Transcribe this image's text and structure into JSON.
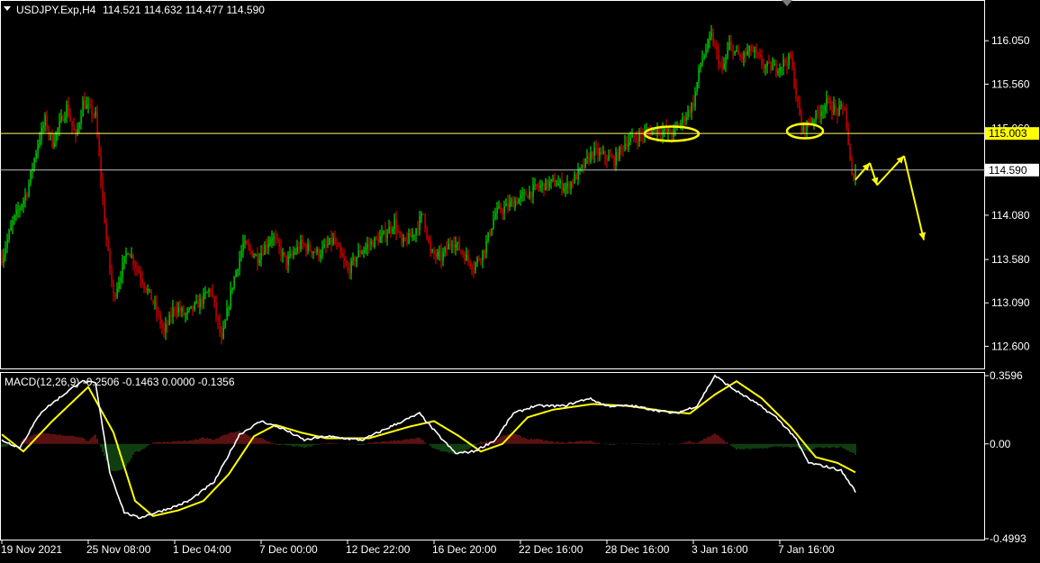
{
  "colors": {
    "background": "#000000",
    "frame": "#ffffff",
    "bull_candle": "#00ff00",
    "bear_candle": "#ff0000",
    "price_line_current": "#c0c0c0",
    "level_line": "#ffff66",
    "level_tag_bg": "#ffff00",
    "macd_main": "#ffffff",
    "macd_signal": "#ffff00",
    "hist_up": "#b22222",
    "hist_down": "#1f7a1f",
    "annotation": "#ffff00"
  },
  "chart_data": [
    {
      "type": "candlestick",
      "title": "USDJPY.Exp,H4",
      "ohlc_header": "114.521 114.632 114.477 114.590",
      "ylim": [
        112.35,
        116.5
      ],
      "y_ticks": [
        "116.050",
        "115.560",
        "115.060",
        "114.080",
        "113.580",
        "113.090",
        "112.600"
      ],
      "y_tick_values": [
        116.05,
        115.56,
        115.06,
        114.08,
        113.58,
        113.09,
        112.6
      ],
      "levels": [
        {
          "value": 115.003,
          "label": "115.003"
        }
      ],
      "current_price": {
        "value": 114.59,
        "label": "114.590"
      },
      "anchor_path": [
        [
          0,
          113.6
        ],
        [
          6,
          114.0
        ],
        [
          14,
          114.35
        ],
        [
          20,
          114.9
        ],
        [
          24,
          115.15
        ],
        [
          28,
          114.9
        ],
        [
          36,
          115.3
        ],
        [
          41,
          114.95
        ],
        [
          45,
          115.35
        ],
        [
          52,
          115.2
        ],
        [
          58,
          113.8
        ],
        [
          62,
          113.15
        ],
        [
          70,
          113.7
        ],
        [
          78,
          113.35
        ],
        [
          84,
          113.1
        ],
        [
          90,
          112.75
        ],
        [
          96,
          113.05
        ],
        [
          102,
          112.95
        ],
        [
          110,
          113.1
        ],
        [
          116,
          113.25
        ],
        [
          122,
          112.65
        ],
        [
          128,
          113.3
        ],
        [
          134,
          113.75
        ],
        [
          142,
          113.6
        ],
        [
          150,
          113.85
        ],
        [
          158,
          113.55
        ],
        [
          166,
          113.75
        ],
        [
          176,
          113.65
        ],
        [
          184,
          113.8
        ],
        [
          192,
          113.45
        ],
        [
          198,
          113.65
        ],
        [
          204,
          113.75
        ],
        [
          212,
          113.85
        ],
        [
          218,
          114.0
        ],
        [
          222,
          113.75
        ],
        [
          228,
          113.85
        ],
        [
          234,
          114.1
        ],
        [
          238,
          113.65
        ],
        [
          244,
          113.6
        ],
        [
          250,
          113.8
        ],
        [
          256,
          113.65
        ],
        [
          262,
          113.5
        ],
        [
          268,
          113.7
        ],
        [
          274,
          114.1
        ],
        [
          282,
          114.2
        ],
        [
          290,
          114.3
        ],
        [
          298,
          114.4
        ],
        [
          306,
          114.45
        ],
        [
          314,
          114.4
        ],
        [
          322,
          114.6
        ],
        [
          328,
          114.8
        ],
        [
          334,
          114.75
        ],
        [
          340,
          114.7
        ],
        [
          346,
          114.9
        ],
        [
          356,
          115.0
        ],
        [
          364,
          115.05
        ],
        [
          372,
          115.0
        ],
        [
          378,
          115.15
        ],
        [
          384,
          115.35
        ],
        [
          388,
          115.8
        ],
        [
          394,
          116.1
        ],
        [
          400,
          115.7
        ],
        [
          404,
          116.0
        ],
        [
          410,
          115.85
        ],
        [
          416,
          115.95
        ],
        [
          424,
          115.75
        ],
        [
          430,
          115.75
        ],
        [
          438,
          115.85
        ],
        [
          444,
          115.05
        ],
        [
          452,
          115.2
        ],
        [
          458,
          115.35
        ],
        [
          464,
          115.25
        ],
        [
          468,
          115.3
        ],
        [
          470,
          114.85
        ],
        [
          472,
          114.5
        ],
        [
          474,
          114.59
        ]
      ]
    },
    {
      "type": "line",
      "title": "MACD(12,26,9) -0.2506 -0.1463 0.0000 -0.1356",
      "ylim": [
        -0.4993,
        0.3596
      ],
      "y_ticks": [
        "0.3596",
        "0.00",
        "-0.4993"
      ],
      "y_tick_values": [
        0.3596,
        0.0,
        -0.4993
      ],
      "x_ticks": [
        "19 Nov 2021",
        "25 Nov 08:00",
        "1 Dec 04:00",
        "7 Dec 00:00",
        "12 Dec 22:00",
        "16 Dec 20:00",
        "22 Dec 16:00",
        "28 Dec 16:00",
        "3 Jan 16:00",
        "7 Jan 16:00"
      ],
      "x_tick_positions": [
        0,
        48,
        96,
        144,
        192,
        240,
        288,
        336,
        384,
        432
      ],
      "macd_anchors": [
        [
          0,
          0.02
        ],
        [
          10,
          -0.02
        ],
        [
          22,
          0.17
        ],
        [
          44,
          0.33
        ],
        [
          52,
          0.32
        ],
        [
          60,
          -0.15
        ],
        [
          68,
          -0.36
        ],
        [
          76,
          -0.39
        ],
        [
          86,
          -0.36
        ],
        [
          96,
          -0.33
        ],
        [
          104,
          -0.3
        ],
        [
          118,
          -0.2
        ],
        [
          132,
          0.05
        ],
        [
          144,
          0.12
        ],
        [
          156,
          0.08
        ],
        [
          168,
          0.02
        ],
        [
          180,
          0.04
        ],
        [
          200,
          0.02
        ],
        [
          218,
          0.1
        ],
        [
          232,
          0.16
        ],
        [
          242,
          0.05
        ],
        [
          252,
          -0.05
        ],
        [
          262,
          -0.04
        ],
        [
          274,
          0.02
        ],
        [
          284,
          0.16
        ],
        [
          296,
          0.2
        ],
        [
          312,
          0.2
        ],
        [
          326,
          0.24
        ],
        [
          336,
          0.2
        ],
        [
          350,
          0.2
        ],
        [
          362,
          0.18
        ],
        [
          374,
          0.16
        ],
        [
          386,
          0.2
        ],
        [
          396,
          0.36
        ],
        [
          406,
          0.29
        ],
        [
          418,
          0.22
        ],
        [
          430,
          0.14
        ],
        [
          440,
          0.04
        ],
        [
          448,
          -0.1
        ],
        [
          458,
          -0.12
        ],
        [
          466,
          -0.14
        ],
        [
          474,
          -0.25
        ]
      ],
      "signal_anchors": [
        [
          0,
          0.05
        ],
        [
          12,
          -0.04
        ],
        [
          28,
          0.12
        ],
        [
          48,
          0.3
        ],
        [
          62,
          0.06
        ],
        [
          74,
          -0.3
        ],
        [
          84,
          -0.38
        ],
        [
          98,
          -0.35
        ],
        [
          112,
          -0.3
        ],
        [
          126,
          -0.16
        ],
        [
          140,
          0.04
        ],
        [
          152,
          0.1
        ],
        [
          166,
          0.06
        ],
        [
          180,
          0.03
        ],
        [
          204,
          0.03
        ],
        [
          226,
          0.09
        ],
        [
          240,
          0.12
        ],
        [
          254,
          0.04
        ],
        [
          266,
          -0.04
        ],
        [
          278,
          0.0
        ],
        [
          292,
          0.14
        ],
        [
          306,
          0.18
        ],
        [
          328,
          0.21
        ],
        [
          348,
          0.2
        ],
        [
          370,
          0.17
        ],
        [
          382,
          0.16
        ],
        [
          396,
          0.26
        ],
        [
          408,
          0.33
        ],
        [
          422,
          0.24
        ],
        [
          438,
          0.09
        ],
        [
          452,
          -0.07
        ],
        [
          464,
          -0.1
        ],
        [
          470,
          -0.13
        ],
        [
          474,
          -0.15
        ]
      ]
    }
  ],
  "annotations": {
    "ellipses": [
      {
        "bar": 372,
        "value": 115.0
      },
      {
        "bar": 446,
        "value": 115.03
      }
    ],
    "arrows_path": [
      [
        474,
        114.48
      ],
      [
        482,
        114.67
      ],
      [
        486,
        114.42
      ],
      [
        501,
        114.75
      ],
      [
        512,
        113.8
      ]
    ]
  }
}
